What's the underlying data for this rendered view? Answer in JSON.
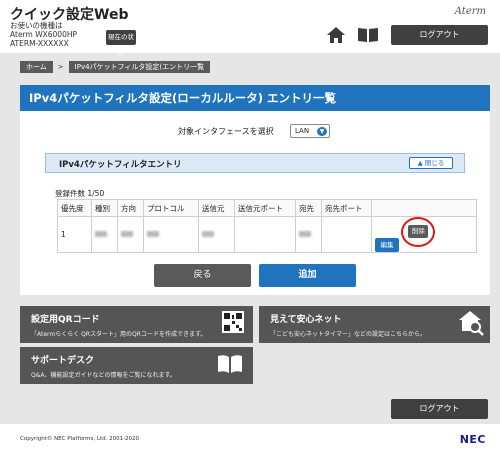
{
  "header": {
    "app_title": "クイック設定Web",
    "model_label": "お使いの機種は",
    "model_name": "Aterm WX6000HP",
    "model_id": "ATERM-XXXXXX",
    "status_button": "現在の状態",
    "brand": "Aterm",
    "logout": "ログアウト",
    "icons": [
      "home-icon",
      "book-icon"
    ]
  },
  "breadcrumb": {
    "home": "ホーム",
    "separator": ">",
    "current": "IPv4パケットフィルタ設定(エントリ一覧"
  },
  "page_title": "IPv4パケットフィルタ設定(ローカルルータ) エントリ一覧",
  "interface": {
    "label": "対象インタフェースを選択",
    "selected": "LAN"
  },
  "section": {
    "title": "IPv4パケットフィルタエントリ",
    "collapse_button": "閉じる"
  },
  "table": {
    "count": "登録件数 1/50",
    "columns": [
      "優先度",
      "種別",
      "方向",
      "プロトコル",
      "送信元",
      "送信元ポート",
      "宛先",
      "宛先ポート",
      ""
    ],
    "rows": [
      {
        "priority": "1",
        "edit": "編集",
        "delete": "削除"
      }
    ]
  },
  "buttons": {
    "back": "戻る",
    "add": "追加"
  },
  "cards": {
    "qr": {
      "title": "設定用QRコード",
      "desc": "「Atermらくらく QRスタート」用のQRコードを作成できます。"
    },
    "safe_net": {
      "title": "見えて安心ネット",
      "desc": "「こども安心ネットタイマー」などの設定はこちらから。"
    },
    "support": {
      "title": "サポートデスク",
      "desc": "Q&A、機能設定ガイドなどの情報をご覧になれます。"
    }
  },
  "footer": {
    "logout": "ログアウト",
    "copyright": "Copyright© NEC Platforms, Ltd. 2001-2020",
    "logo": "NEC"
  },
  "colors": {
    "accent_blue": "#1f74bd",
    "dark_button": "#404040",
    "highlight_red": "#e01515"
  }
}
